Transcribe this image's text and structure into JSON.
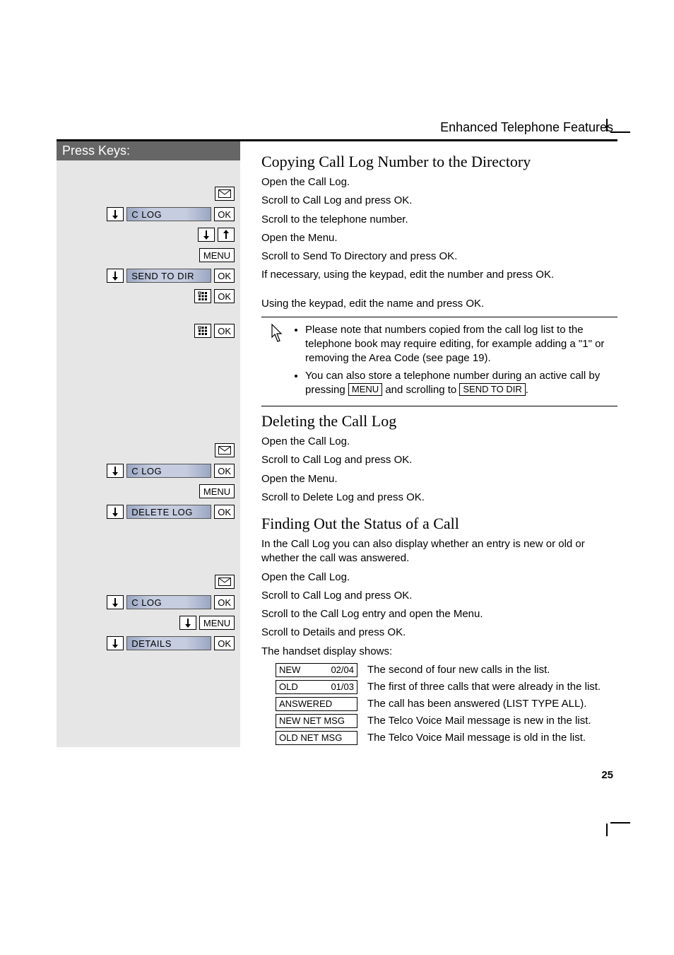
{
  "header": {
    "title": "Enhanced Telephone Features"
  },
  "pressKeys": {
    "label": "Press Keys:"
  },
  "keys": {
    "ok": "OK",
    "menu": "MENU",
    "clog": "C LOG",
    "sendToDir": "SEND TO DIR",
    "deleteLog": "DELETE LOG",
    "details": "DETAILS"
  },
  "section1": {
    "title": "Copying Call Log Number to the Directory",
    "steps": {
      "s1": "Open the Call Log.",
      "s2": "Scroll to Call Log and press OK.",
      "s3": "Scroll to the telephone number.",
      "s4": "Open the Menu.",
      "s5": "Scroll to Send To Directory and press OK.",
      "s6": "If necessary, using the keypad, edit the number and press OK.",
      "s7": "Using the keypad, edit the name and press OK."
    },
    "notes": {
      "n1a": "Please note that numbers copied from the call log list to the telephone book may require editing, for example adding a \"1\" or removing the Area Code (see page 19).",
      "n2a": "You can also store a telephone number during an active call by pressing ",
      "n2key": "MENU",
      "n2b": " and scrolling to ",
      "n2key2": "SEND TO DIR",
      "n2c": "."
    }
  },
  "section2": {
    "title": "Deleting the Call Log",
    "steps": {
      "s1": "Open the Call Log.",
      "s2": "Scroll to Call Log and press OK.",
      "s3": "Open the Menu.",
      "s4": "Scroll to Delete Log and press OK."
    }
  },
  "section3": {
    "title": "Finding Out the Status of a Call",
    "intro": "In the Call Log you can also display whether an entry is new or old or whether the call was answered.",
    "steps": {
      "s1": "Open the Call Log.",
      "s2": "Scroll to Call Log and press OK.",
      "s3": "Scroll to the Call Log entry and open the Menu.",
      "s4": "Scroll to Details and press OK.",
      "s5": "The handset display shows:"
    },
    "status": {
      "r1": {
        "label": "NEW",
        "count": "02/04",
        "desc": "The second of four new calls in the list."
      },
      "r2": {
        "label": "OLD",
        "count": "01/03",
        "desc": "The first of three calls that were already in the list."
      },
      "r3": {
        "label": "ANSWERED",
        "desc": "The call has been answered (LIST TYPE ALL)."
      },
      "r4": {
        "label": "NEW NET MSG",
        "desc": "The Telco Voice Mail message is new in the list."
      },
      "r5": {
        "label": "OLD NET MSG",
        "desc": "The Telco Voice Mail message is old in the list."
      }
    }
  },
  "pageNumber": "25"
}
